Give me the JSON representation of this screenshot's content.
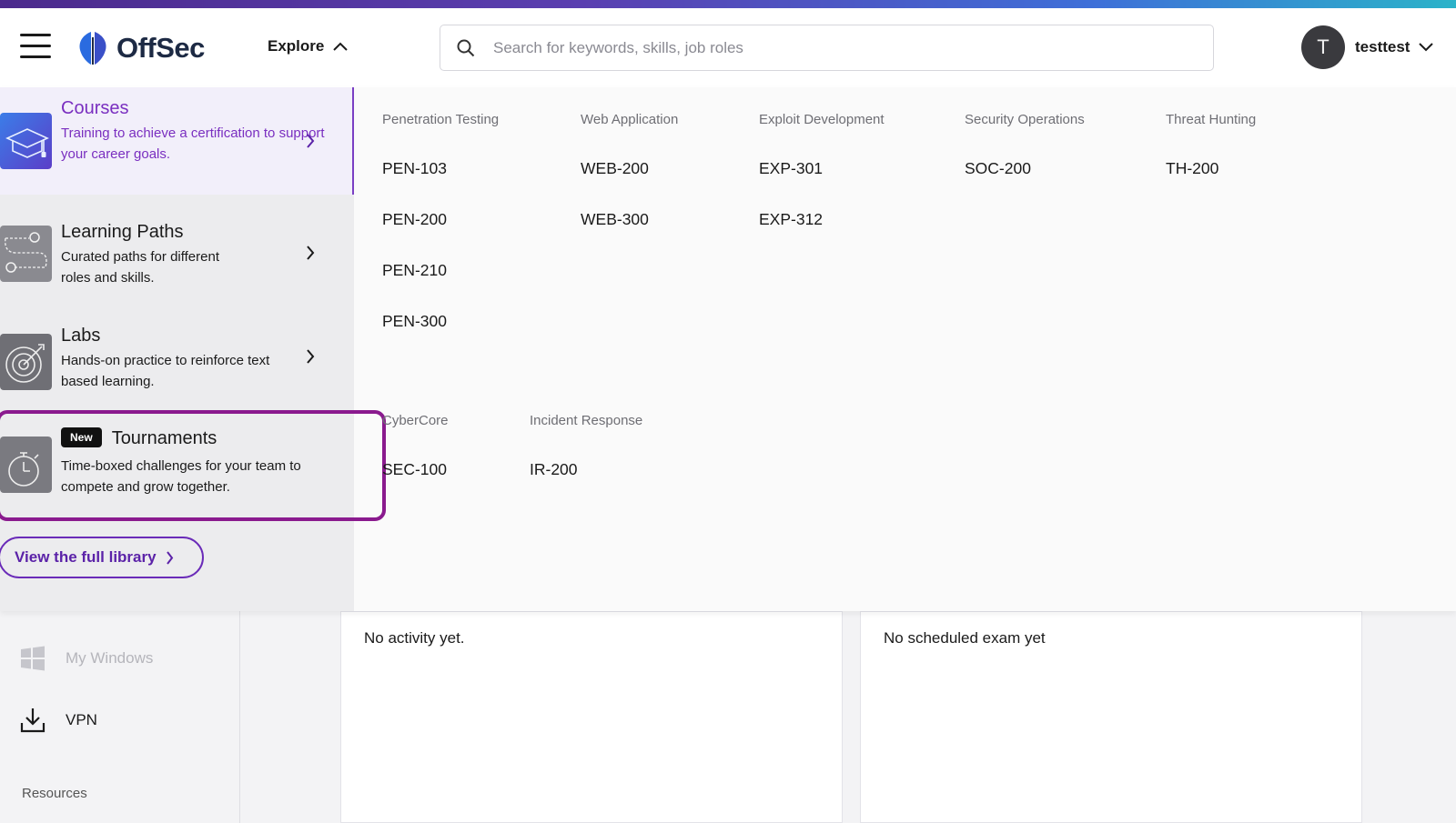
{
  "header": {
    "logo_text": "OffSec",
    "explore_label": "Explore",
    "search_placeholder": "Search for keywords, skills, job roles",
    "user": {
      "initial": "T",
      "name": "testtest"
    }
  },
  "menu": {
    "items": [
      {
        "title": "Courses",
        "desc": "Training to achieve a certification to support your career goals."
      },
      {
        "title": "Learning Paths",
        "desc": "Curated paths for different roles and skills."
      },
      {
        "title": "Labs",
        "desc": "Hands-on practice to reinforce text based learning."
      },
      {
        "badge": "New",
        "title": "Tournaments",
        "desc": "Time-boxed challenges for your team to compete and grow together."
      }
    ],
    "full_library_label": "View the full library"
  },
  "categories": [
    {
      "name": "Penetration Testing",
      "courses": [
        "PEN-103",
        "PEN-200",
        "PEN-210",
        "PEN-300"
      ]
    },
    {
      "name": "Web Application",
      "courses": [
        "WEB-200",
        "WEB-300"
      ]
    },
    {
      "name": "Exploit Development",
      "courses": [
        "EXP-301",
        "EXP-312"
      ]
    },
    {
      "name": "Security Operations",
      "courses": [
        "SOC-200"
      ]
    },
    {
      "name": "Threat Hunting",
      "courses": [
        "TH-200"
      ]
    },
    {
      "name": "CyberCore",
      "courses": [
        "SEC-100"
      ]
    },
    {
      "name": "Incident Response",
      "courses": [
        "IR-200"
      ]
    }
  ],
  "background": {
    "nav": [
      {
        "label": "My Windows",
        "icon": "windows-icon"
      },
      {
        "label": "VPN",
        "icon": "download-icon"
      }
    ],
    "section_label": "Resources",
    "activity_card_text": "No activity yet.",
    "exam_card_text": "No scheduled exam yet"
  },
  "colors": {
    "accent_purple": "#7a2fc0",
    "highlight_border": "#8a1a8e",
    "avatar_bg": "#3a3a3e"
  }
}
